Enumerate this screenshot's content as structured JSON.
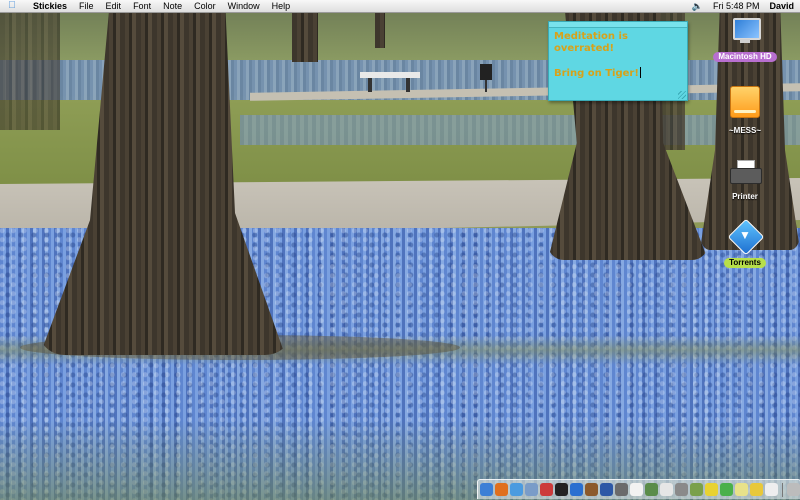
{
  "menubar": {
    "apple_icon": "apple-icon",
    "app_name": "Stickies",
    "menus": [
      "File",
      "Edit",
      "Font",
      "Note",
      "Color",
      "Window",
      "Help"
    ],
    "volume_icon": "speaker-icon",
    "clock": "Fri 5:48 PM",
    "user": "David"
  },
  "sticky": {
    "color": "#5fd7e3",
    "text_color": "#d7a21a",
    "lines": [
      "Meditation is",
      "overrated!",
      "Bring on Tiger!"
    ]
  },
  "desktop_icons": [
    {
      "label": "Macintosh HD",
      "icon": "computer-icon"
    },
    {
      "label": "~MESS~",
      "icon": "hard-drive-icon"
    },
    {
      "label": "Printer",
      "icon": "printer-icon"
    },
    {
      "label": "Torrents",
      "icon": "torrent-folder-icon"
    }
  ],
  "dock": {
    "items": [
      {
        "icon": "finder-icon",
        "color": "#3c7fd6"
      },
      {
        "icon": "firefox-icon",
        "color": "#e0701d"
      },
      {
        "icon": "safari-icon",
        "color": "#4b9be0"
      },
      {
        "icon": "mail-icon",
        "color": "#7a9cc8"
      },
      {
        "icon": "ical-icon",
        "color": "#cc3b3b"
      },
      {
        "icon": "terminal-icon",
        "color": "#222222"
      },
      {
        "icon": "itunes-icon",
        "color": "#2a6fd0"
      },
      {
        "icon": "photoshop-icon",
        "color": "#8c5a2b"
      },
      {
        "icon": "word-icon",
        "color": "#2d58a6"
      },
      {
        "icon": "photo-icon",
        "color": "#6b6b6b"
      },
      {
        "icon": "quicktime-icon",
        "color": "#f2f2f2"
      },
      {
        "icon": "preview-icon",
        "color": "#5a8c4a"
      },
      {
        "icon": "textedit-icon",
        "color": "#e6e6e6"
      },
      {
        "icon": "system-preferences-icon",
        "color": "#8a8a8a"
      },
      {
        "icon": "address-book-icon",
        "color": "#7aa04a"
      },
      {
        "icon": "lemon-icon",
        "color": "#e8d232"
      },
      {
        "icon": "chat-icon",
        "color": "#4ab04a"
      },
      {
        "icon": "stickies-icon",
        "color": "#e8e28a"
      },
      {
        "icon": "adium-icon",
        "color": "#e8c83a"
      },
      {
        "icon": "mail-envelope-icon",
        "color": "#eeeeee"
      },
      {
        "icon": "trash-icon",
        "color": "#bcbcbc"
      }
    ]
  }
}
